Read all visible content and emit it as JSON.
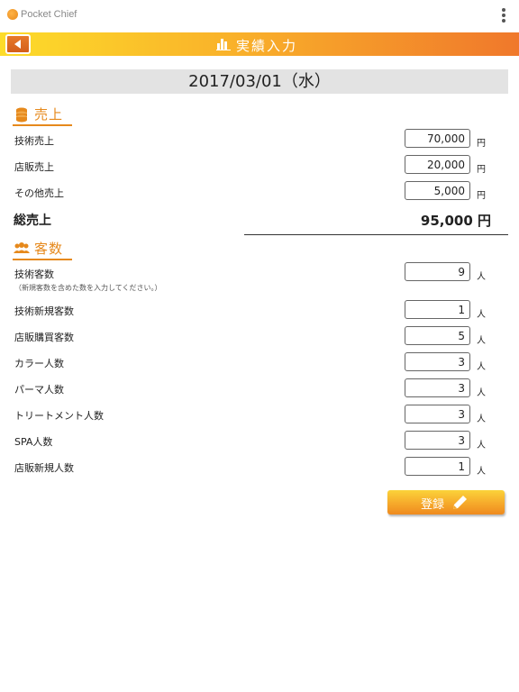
{
  "app": {
    "title": "Pocket Chief"
  },
  "header": {
    "title": "実績入力"
  },
  "date": "2017/03/01（水）",
  "sales": {
    "heading": "売上",
    "rows": [
      {
        "label": "技術売上",
        "value": "70,000",
        "unit": "円"
      },
      {
        "label": "店販売上",
        "value": "20,000",
        "unit": "円"
      },
      {
        "label": "その他売上",
        "value": "5,000",
        "unit": "円"
      }
    ],
    "total_label": "総売上",
    "total_value": "95,000 円"
  },
  "customers": {
    "heading": "客数",
    "note": "（新規客数を含めた数を入力してください。）",
    "rows": [
      {
        "label": "技術客数",
        "value": "9",
        "unit": "人"
      },
      {
        "label": "技術新規客数",
        "value": "1",
        "unit": "人"
      },
      {
        "label": "店販購買客数",
        "value": "5",
        "unit": "人"
      },
      {
        "label": "カラー人数",
        "value": "3",
        "unit": "人"
      },
      {
        "label": "パーマ人数",
        "value": "3",
        "unit": "人"
      },
      {
        "label": "トリートメント人数",
        "value": "3",
        "unit": "人"
      },
      {
        "label": "SPA人数",
        "value": "3",
        "unit": "人"
      },
      {
        "label": "店販新規人数",
        "value": "1",
        "unit": "人"
      }
    ]
  },
  "submit": {
    "label": "登録"
  },
  "colors": {
    "accent": "#e6891c",
    "bar_start": "#fddc2a",
    "bar_end": "#f0782b"
  }
}
